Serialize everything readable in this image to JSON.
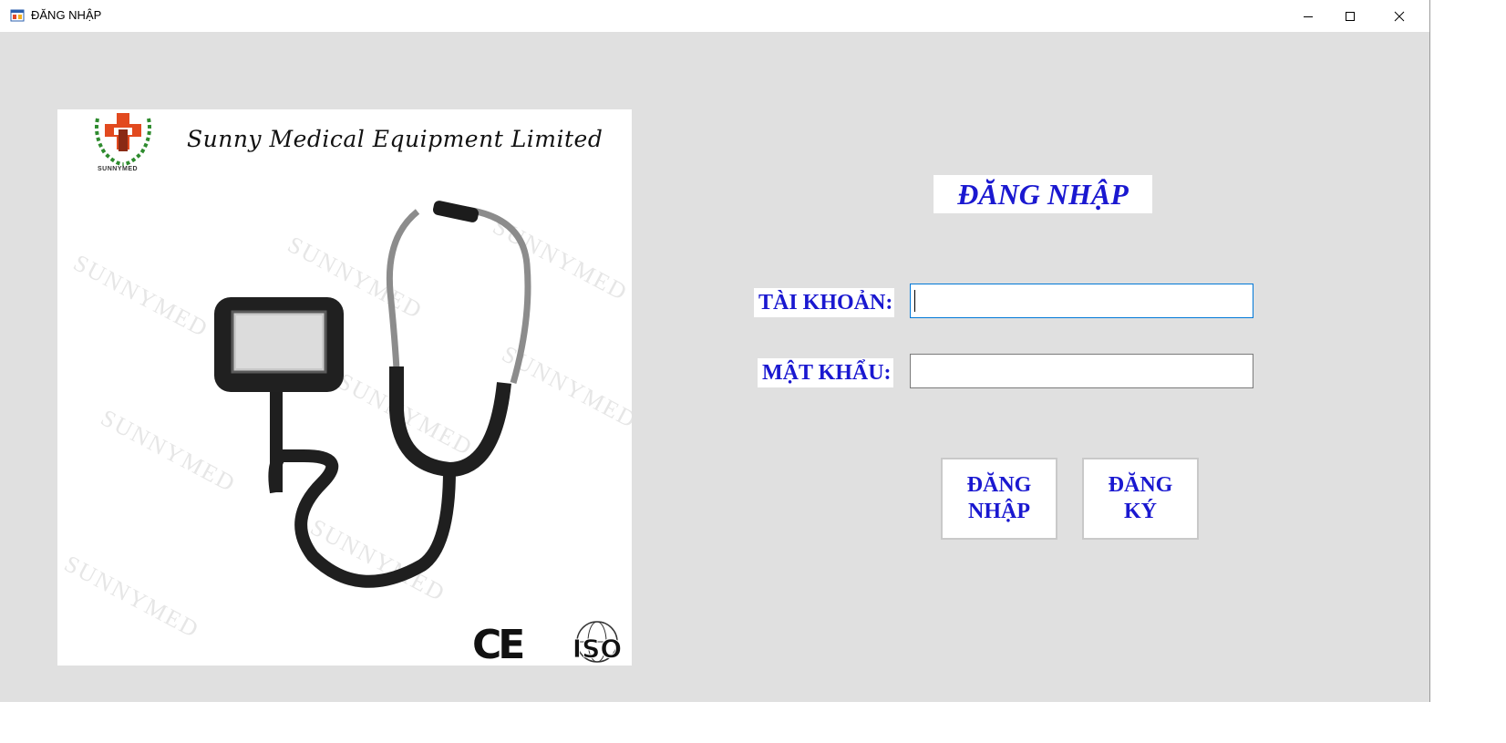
{
  "window": {
    "title": "ĐĂNG NHẬP",
    "icon": "form-app-icon",
    "controls": [
      "minimize-icon",
      "maximize-icon",
      "close-icon"
    ]
  },
  "product_image": {
    "brand": "Sunny Medical Equipment Limited",
    "logo_caption": "SUNNYMED",
    "watermark": "SUNNYMED",
    "certification_marks": {
      "ce": "CE",
      "iso": "ISO"
    }
  },
  "login": {
    "title": "ĐĂNG NHẬP",
    "username_label": "TÀI KHOẢN:",
    "username_value": "",
    "password_label": "MẬT KHẨU:",
    "password_value": "",
    "login_button": [
      "ĐĂNG",
      "NHẬP"
    ],
    "register_button": [
      "ĐĂNG",
      "KÝ"
    ]
  },
  "colors": {
    "accent_text": "#1a18d0",
    "form_background": "#e0e0e0",
    "focus_border": "#0078d7"
  }
}
